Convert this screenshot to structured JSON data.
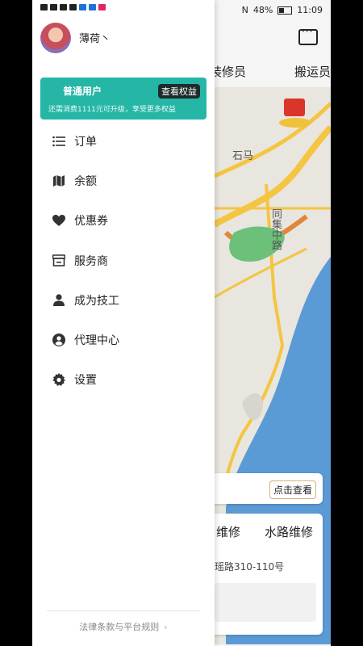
{
  "status_bar": {
    "left_icons": [
      "hd-icon",
      "signal-icon",
      "wifi-icon",
      "app-icon",
      "app-icon",
      "play-icon"
    ],
    "battery_percent": "48%",
    "time": "11:09"
  },
  "user": {
    "name": "薄荷丶"
  },
  "membership": {
    "level": "普通用户",
    "view_rights_label": "查看权益",
    "upgrade_hint": "还需消费1111元可升级，享受更多权益"
  },
  "menu": [
    {
      "label": "订单",
      "icon": "list-icon"
    },
    {
      "label": "余额",
      "icon": "map-icon"
    },
    {
      "label": "优惠券",
      "icon": "heart-icon"
    },
    {
      "label": "服务商",
      "icon": "store-icon"
    },
    {
      "label": "成为技工",
      "icon": "person-icon"
    },
    {
      "label": "代理中心",
      "icon": "user-circle-icon"
    },
    {
      "label": "设置",
      "icon": "gear-icon"
    }
  ],
  "footer": {
    "legal_link": "法律条款与平台规则"
  },
  "background": {
    "tabs": [
      "装修员",
      "搬运员"
    ],
    "map_labels": [
      "石马",
      "同集中路"
    ],
    "view_button": "点击查看",
    "service_tabs": [
      "维修",
      "水路维修"
    ],
    "address": "瑶路310-110号"
  },
  "colors": {
    "accent": "#26b6a6",
    "rights_badge": "#1d2b2a",
    "water": "#5b9bd5",
    "road": "#f4c542"
  }
}
